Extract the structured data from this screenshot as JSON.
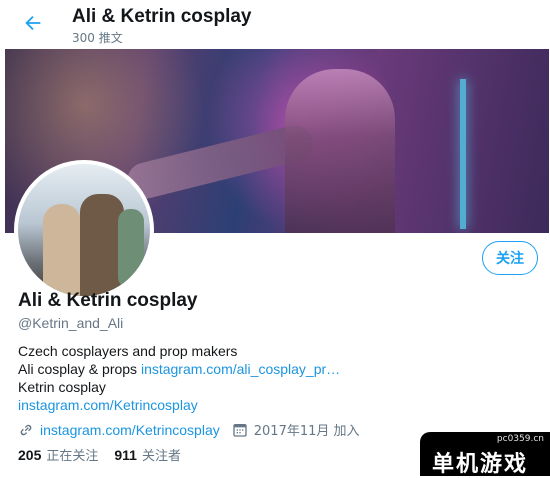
{
  "header": {
    "title": "Ali & Ketrin cosplay",
    "tweet_count": "300 推文"
  },
  "profile": {
    "follow_label": "关注",
    "name": "Ali & Ketrin cosplay",
    "handle": "@Ketrin_and_Ali",
    "bio": {
      "line1": "Czech cosplayers and prop makers",
      "line2_text": "Ali cosplay & props ",
      "line2_link": "instagram.com/ali_cosplay_pr…",
      "line3": "Ketrin cosplay",
      "line4_link": "instagram.com/Ketrincosplay"
    },
    "website": "instagram.com/Ketrincosplay",
    "joined": "2017年11月 加入",
    "following_count": "205",
    "following_label": "正在关注",
    "followers_count": "911",
    "followers_label": "关注者"
  },
  "watermark": {
    "site": "pc0359.cn",
    "brand": "单机游戏"
  },
  "colors": {
    "accent": "#1da1f2",
    "link": "#1b95e0",
    "muted": "#657786"
  },
  "icons": {
    "back": "arrow-left-icon",
    "website": "link-icon",
    "joined": "calendar-icon"
  }
}
